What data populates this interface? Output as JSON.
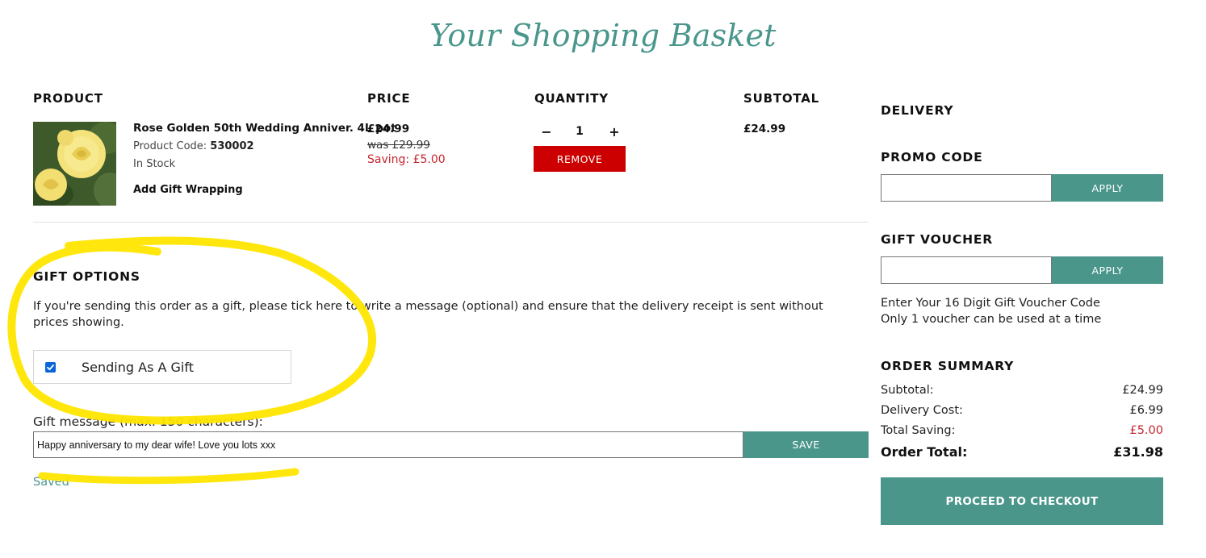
{
  "page_title": "Your Shopping Basket",
  "table": {
    "headers": {
      "product": "PRODUCT",
      "price": "PRICE",
      "quantity": "QUANTITY",
      "subtotal": "SUBTOTAL"
    }
  },
  "item": {
    "name": "Rose Golden 50th Wedding Anniver. 4L pot",
    "code_label": "Product Code: ",
    "code": "530002",
    "stock": "In Stock",
    "gift_wrap": "Add Gift Wrapping",
    "price": "£24.99",
    "was_price": "was £29.99",
    "saving": "Saving: £5.00",
    "qty_minus": "−",
    "qty": "1",
    "qty_plus": "+",
    "remove": "REMOVE",
    "subtotal": "£24.99"
  },
  "gift": {
    "heading": "GIFT OPTIONS",
    "description": "If you're sending this order as a gift, please tick here to write a message (optional) and ensure that the delivery receipt is sent without prices showing.",
    "checkbox_label": "Sending As A Gift",
    "checked": true,
    "message_label": "Gift message (max. 150 characters):",
    "message_value": "Happy anniversary to my dear wife! Love you lots xxx",
    "save": "SAVE",
    "saved_status": "Saved"
  },
  "sidebar": {
    "delivery_heading": "DELIVERY",
    "promo_heading": "PROMO CODE",
    "promo_apply": "APPLY",
    "voucher_heading": "GIFT VOUCHER",
    "voucher_apply": "APPLY",
    "voucher_note_1": "Enter Your 16 Digit Gift Voucher Code",
    "voucher_note_2": "Only 1 voucher can be used at a time",
    "summary_heading": "ORDER SUMMARY",
    "summary": {
      "subtotal_label": "Subtotal:",
      "subtotal_value": "£24.99",
      "delivery_label": "Delivery Cost:",
      "delivery_value": "£6.99",
      "saving_label": "Total Saving:",
      "saving_value": "£5.00",
      "total_label": "Order Total:",
      "total_value": "£31.98"
    },
    "checkout": "PROCEED TO CHECKOUT"
  },
  "colors": {
    "accent": "#4a968b",
    "remove": "#cc0000",
    "saving": "#c4262e",
    "highlight": "#ffe600"
  },
  "icons": {
    "checkbox": "checkmark-icon",
    "rose": "rose-flower-image"
  }
}
